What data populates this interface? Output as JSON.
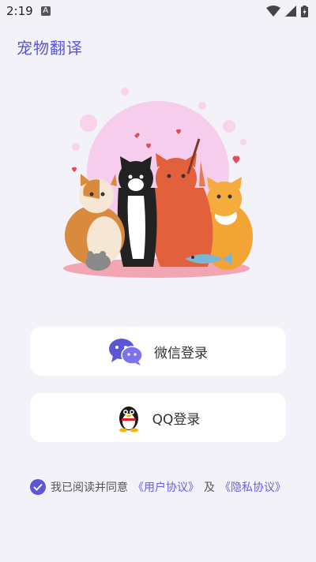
{
  "status_bar": {
    "time": "2:19",
    "notification_icon": "A"
  },
  "app": {
    "title": "宠物翻译"
  },
  "login": {
    "wechat_label": "微信登录",
    "qq_label": "QQ登录"
  },
  "agreement": {
    "prefix": "我已阅读并同意",
    "user_agreement": "《用户协议》",
    "conjunction": "及",
    "privacy_policy": "《隐私协议》",
    "checked": true
  },
  "colors": {
    "accent": "#5b56d6",
    "background": "#f2f2f8"
  }
}
